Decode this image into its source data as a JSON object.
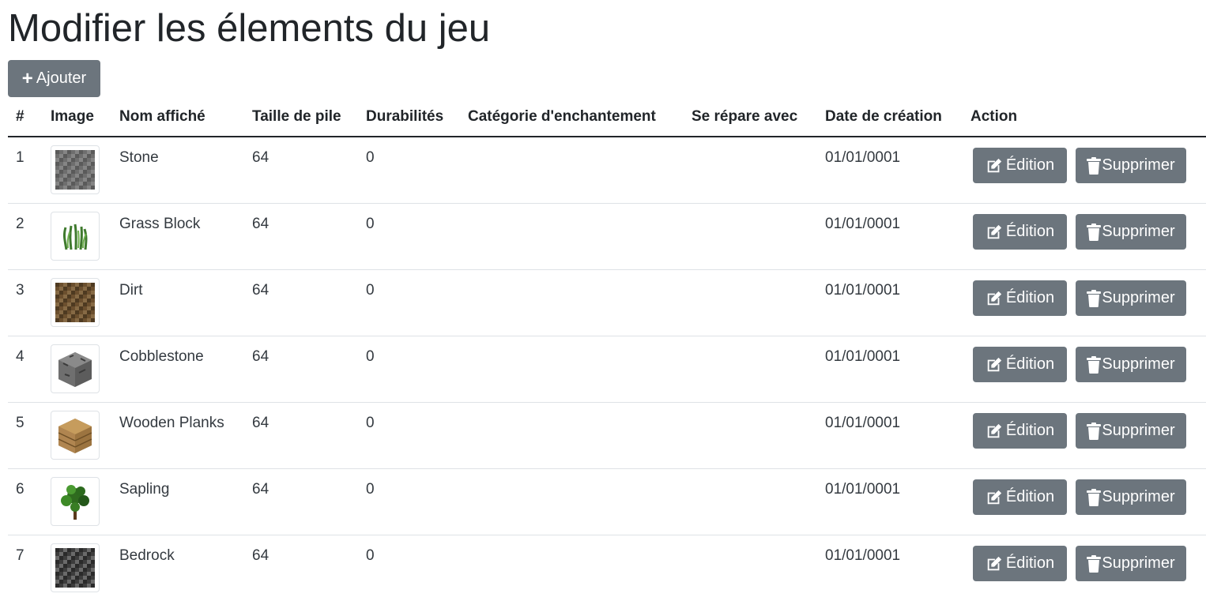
{
  "page": {
    "title": "Modifier les élements du jeu",
    "add_button": "Ajouter"
  },
  "table": {
    "headers": [
      "#",
      "Image",
      "Nom affiché",
      "Taille de pile",
      "Durabilités",
      "Catégorie d'enchantement",
      "Se répare avec",
      "Date de création",
      "Action"
    ],
    "rows": [
      {
        "id": "1",
        "image": "stone-block-icon",
        "name": "Stone",
        "stack_size": "64",
        "durability": "0",
        "enchant_category": "",
        "repair_with": "",
        "created": "01/01/0001"
      },
      {
        "id": "2",
        "image": "grass-block-icon",
        "name": "Grass Block",
        "stack_size": "64",
        "durability": "0",
        "enchant_category": "",
        "repair_with": "",
        "created": "01/01/0001"
      },
      {
        "id": "3",
        "image": "dirt-block-icon",
        "name": "Dirt",
        "stack_size": "64",
        "durability": "0",
        "enchant_category": "",
        "repair_with": "",
        "created": "01/01/0001"
      },
      {
        "id": "4",
        "image": "cobblestone-block-icon",
        "name": "Cobblestone",
        "stack_size": "64",
        "durability": "0",
        "enchant_category": "",
        "repair_with": "",
        "created": "01/01/0001"
      },
      {
        "id": "5",
        "image": "wooden-planks-block-icon",
        "name": "Wooden Planks",
        "stack_size": "64",
        "durability": "0",
        "enchant_category": "",
        "repair_with": "",
        "created": "01/01/0001"
      },
      {
        "id": "6",
        "image": "sapling-icon",
        "name": "Sapling",
        "stack_size": "64",
        "durability": "0",
        "enchant_category": "",
        "repair_with": "",
        "created": "01/01/0001"
      },
      {
        "id": "7",
        "image": "bedrock-block-icon",
        "name": "Bedrock",
        "stack_size": "64",
        "durability": "0",
        "enchant_category": "",
        "repair_with": "",
        "created": "01/01/0001"
      }
    ],
    "edit_label": "Édition",
    "delete_label": "Supprimer"
  },
  "colors": {
    "button_bg": "#6c757d",
    "text": "#212529",
    "row_border": "#dee2e6"
  }
}
